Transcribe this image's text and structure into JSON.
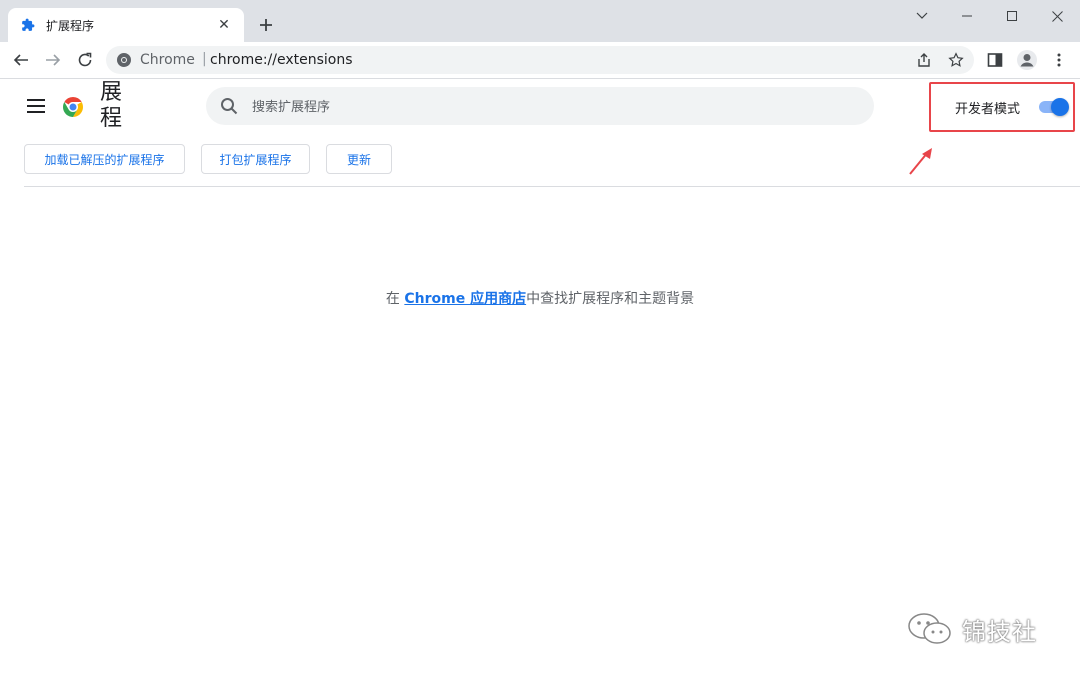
{
  "window": {
    "tab_title": "扩展程序",
    "tab_close": "✕",
    "new_tab": "+",
    "controls": [
      "chevron-down",
      "minimize",
      "maximize",
      "close"
    ]
  },
  "toolbar": {
    "url_host": "Chrome",
    "url_separator": "|",
    "url_path": "chrome://extensions"
  },
  "header": {
    "title": "扩展程序",
    "title_visible": "展程",
    "search_placeholder": "搜索扩展程序",
    "dev_mode_label": "开发者模式",
    "dev_mode_on": true
  },
  "actions": [
    {
      "label": "加载已解压的扩展程序"
    },
    {
      "label": "打包扩展程序"
    },
    {
      "label": "更新"
    }
  ],
  "empty_state": {
    "prefix": "在 ",
    "link": "Chrome 应用商店",
    "suffix": "中查找扩展程序和主题背景"
  },
  "watermark": {
    "text": "锦技社"
  },
  "colors": {
    "accent": "#1a73e8",
    "highlight_box": "#e8454a",
    "tabstrip": "#dee1e6"
  }
}
